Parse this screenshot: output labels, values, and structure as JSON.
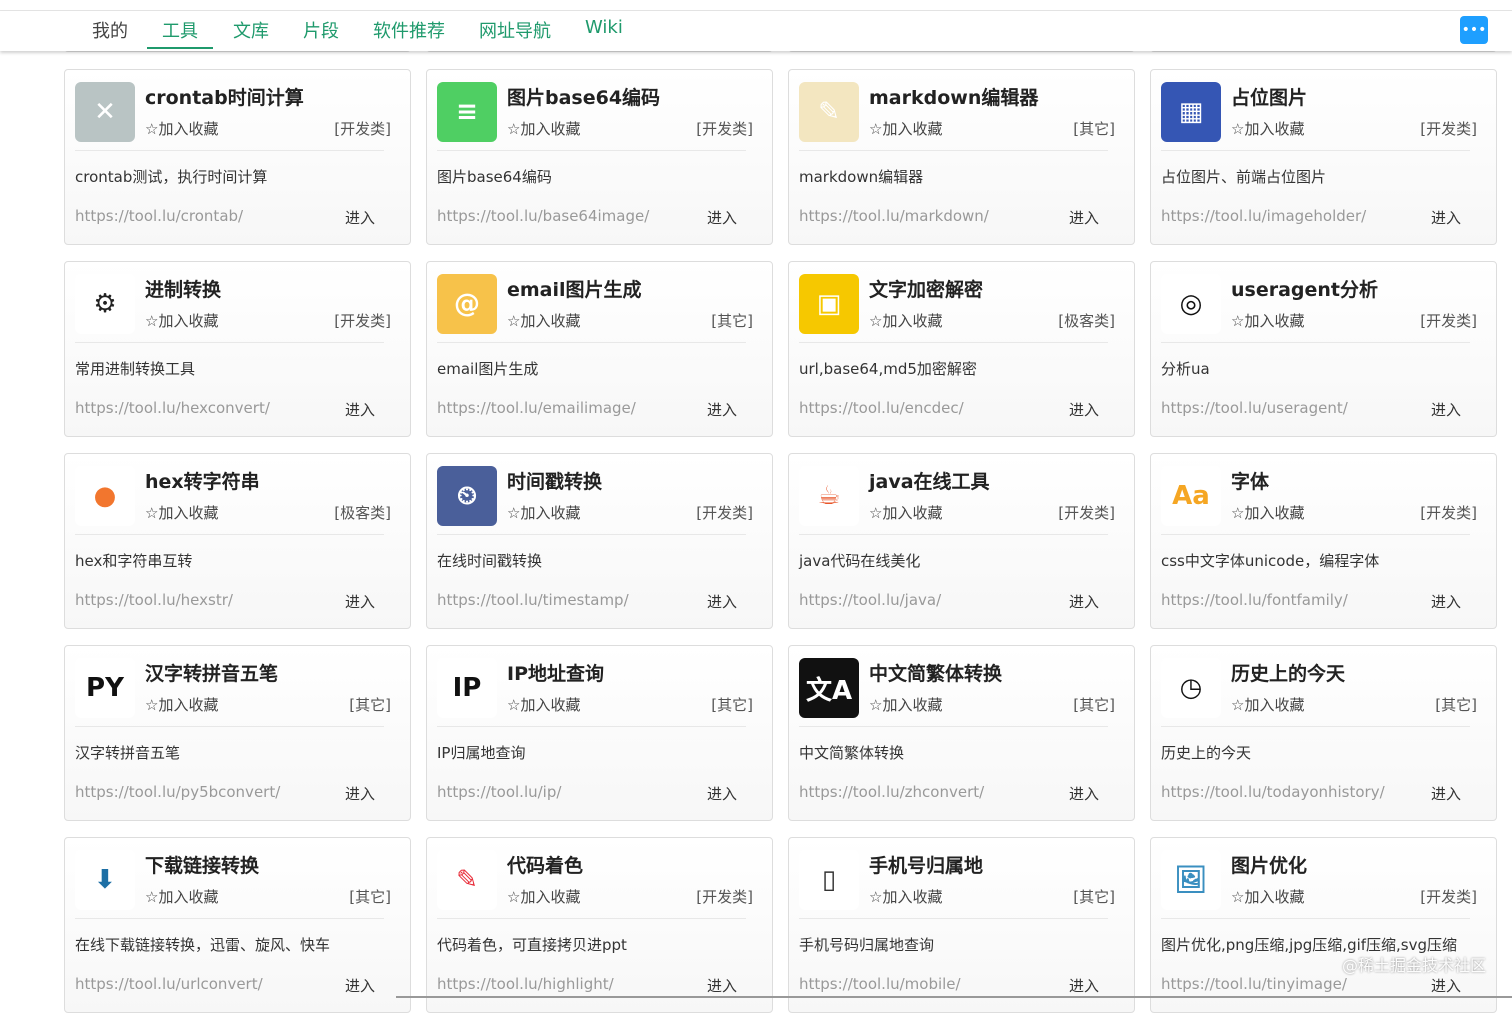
{
  "nav": {
    "items": [
      "我的",
      "工具",
      "文库",
      "片段",
      "软件推荐",
      "网址导航",
      "Wiki"
    ],
    "active": "工具",
    "chat_icon": "chat-icon"
  },
  "fav_label": "加入收藏",
  "enter_label": "进入",
  "star_icon": "☆",
  "watermark": "@稀土掘金技术社区",
  "cards": [
    {
      "title": "crontab时间计算",
      "category": "[开发类]",
      "desc": "crontab测试，执行时间计算",
      "url": "https://tool.lu/crontab/",
      "icon": "crontab-icon",
      "color": "#b9c4c4",
      "glyph": "✕"
    },
    {
      "title": "图片base64编码",
      "category": "[开发类]",
      "desc": "图片base64编码",
      "url": "https://tool.lu/base64image/",
      "icon": "server-icon",
      "color": "#4fcf63",
      "glyph": "≡"
    },
    {
      "title": "markdown编辑器",
      "category": "[其它]",
      "desc": "markdown编辑器",
      "url": "https://tool.lu/markdown/",
      "icon": "notepad-icon",
      "color": "#f3e6c0",
      "glyph": "✎"
    },
    {
      "title": "占位图片",
      "category": "[开发类]",
      "desc": "占位图片、前端占位图片",
      "url": "https://tool.lu/imageholder/",
      "icon": "placeholder-image-icon",
      "color": "#3556b4",
      "glyph": "▦"
    },
    {
      "title": "进制转换",
      "category": "[开发类]",
      "desc": "常用进制转换工具",
      "url": "https://tool.lu/hexconvert/",
      "icon": "binary-gear-icon",
      "color": "#fff",
      "glyph": "⚙",
      "fg": "#222"
    },
    {
      "title": "email图片生成",
      "category": "[其它]",
      "desc": "email图片生成",
      "url": "https://tool.lu/emailimage/",
      "icon": "email-icon",
      "color": "#f7c24a",
      "glyph": "@"
    },
    {
      "title": "文字加密解密",
      "category": "[极客类]",
      "desc": "url,base64,md5加密解密",
      "url": "https://tool.lu/encdec/",
      "icon": "encrypt-icon",
      "color": "#f6c800",
      "glyph": "▣"
    },
    {
      "title": "useragent分析",
      "category": "[开发类]",
      "desc": "分析ua",
      "url": "https://tool.lu/useragent/",
      "icon": "browser-icon",
      "color": "#fff",
      "glyph": "◎",
      "fg": "#111"
    },
    {
      "title": "hex转字符串",
      "category": "[极客类]",
      "desc": "hex和字符串互转",
      "url": "https://tool.lu/hexstr/",
      "icon": "dots-icon",
      "color": "#fff",
      "glyph": "●",
      "fg": "#f2762e"
    },
    {
      "title": "时间戳转换",
      "category": "[开发类]",
      "desc": "在线时间戳转换",
      "url": "https://tool.lu/timestamp/",
      "icon": "clock-icon",
      "color": "#4a5f9a",
      "glyph": "⏲"
    },
    {
      "title": "java在线工具",
      "category": "[开发类]",
      "desc": "java代码在线美化",
      "url": "https://tool.lu/java/",
      "icon": "java-icon",
      "color": "#fff",
      "glyph": "☕",
      "fg": "#e8562a"
    },
    {
      "title": "字体",
      "category": "[开发类]",
      "desc": "css中文字体unicode，编程字体",
      "url": "https://tool.lu/fontfamily/",
      "icon": "font-icon",
      "color": "#fff",
      "glyph": "Aa",
      "fg": "#f5a623"
    },
    {
      "title": "汉字转拼音五笔",
      "category": "[其它]",
      "desc": "汉字转拼音五笔",
      "url": "https://tool.lu/py5bconvert/",
      "icon": "pinyin-icon",
      "color": "#fff",
      "glyph": "PY",
      "fg": "#111"
    },
    {
      "title": "IP地址查询",
      "category": "[其它]",
      "desc": "IP归属地查询",
      "url": "https://tool.lu/ip/",
      "icon": "ip-location-icon",
      "color": "#fff",
      "glyph": "IP",
      "fg": "#111"
    },
    {
      "title": "中文简繁体转换",
      "category": "[其它]",
      "desc": "中文简繁体转换",
      "url": "https://tool.lu/zhconvert/",
      "icon": "translate-icon",
      "color": "#111",
      "glyph": "文A"
    },
    {
      "title": "历史上的今天",
      "category": "[其它]",
      "desc": "历史上的今天",
      "url": "https://tool.lu/todayonhistory/",
      "icon": "calendar-icon",
      "color": "#fff",
      "glyph": "◷",
      "fg": "#111"
    },
    {
      "title": "下载链接转换",
      "category": "[其它]",
      "desc": "在线下载链接转换，迅雷、旋风、快车",
      "url": "https://tool.lu/urlconvert/",
      "icon": "download-icon",
      "color": "#fff",
      "glyph": "⬇",
      "fg": "#1d6fa5"
    },
    {
      "title": "代码着色",
      "category": "[开发类]",
      "desc": "代码着色，可直接拷贝进ppt",
      "url": "https://tool.lu/highlight/",
      "icon": "highlighter-icon",
      "color": "#fff",
      "glyph": "✎",
      "fg": "#e8303c"
    },
    {
      "title": "手机号归属地",
      "category": "[其它]",
      "desc": "手机号码归属地查询",
      "url": "https://tool.lu/mobile/",
      "icon": "phone-icon",
      "color": "#fff",
      "glyph": "▯",
      "fg": "#333"
    },
    {
      "title": "图片优化",
      "category": "[开发类]",
      "desc": "图片优化,png压缩,jpg压缩,gif压缩,svg压缩",
      "url": "https://tool.lu/tinyimage/",
      "icon": "image-icon",
      "color": "#fff",
      "glyph": "🖼",
      "fg": "#3a8fc0"
    }
  ]
}
